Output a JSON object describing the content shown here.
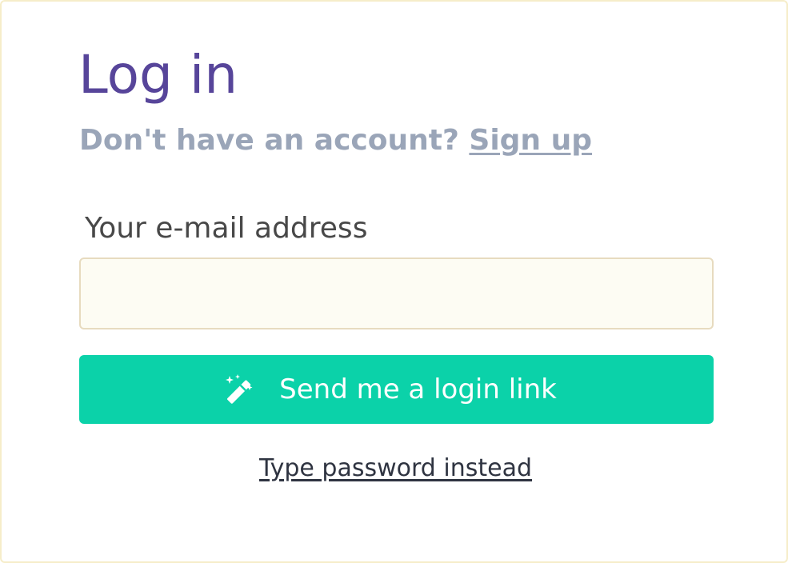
{
  "login": {
    "title": "Log in",
    "subtitle_prefix": "Don't have an account? ",
    "signup_link": "Sign up",
    "email_label": "Your e-mail address",
    "email_value": "",
    "email_placeholder": "",
    "submit_button": {
      "icon": "magic-wand-icon",
      "label": "Send me a login link"
    },
    "password_link": "Type password instead"
  },
  "colors": {
    "title": "#57459a",
    "muted": "#9aa5b8",
    "label": "#484848",
    "input_bg": "#fdfcf3",
    "input_border": "#e7dbbf",
    "button_bg": "#0bd2a9",
    "button_text": "#ffffff",
    "link": "#2f3441",
    "card_border": "#f6edc9"
  }
}
